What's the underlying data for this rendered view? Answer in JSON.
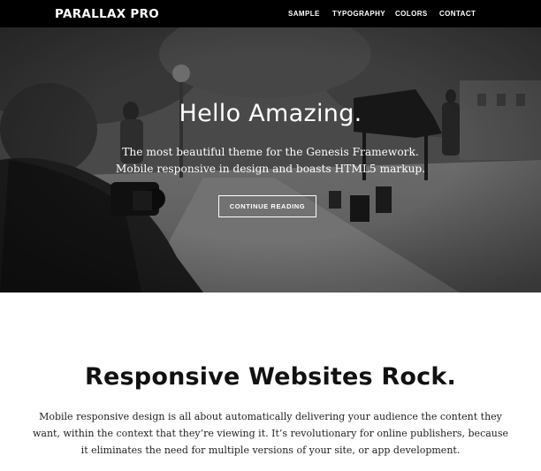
{
  "header": {
    "site_title": "PARALLAX PRO",
    "nav": [
      "SAMPLE",
      "TYPOGRAPHY",
      "COLORS",
      "CONTACT"
    ]
  },
  "hero": {
    "title": "Hello Amazing.",
    "lines": [
      "The most beautiful theme for the Genesis Framework.",
      "Mobile responsive in design and boasts HTML5 markup."
    ],
    "button_label": "CONTINUE READING"
  },
  "section": {
    "title": "Responsive Websites Rock.",
    "lines": [
      "Mobile responsive design is all about automatically delivering your audience the content they",
      "want, within the context that they’re viewing it. It’s revolutionary for online publishers, because",
      "it eliminates the need for multiple versions of your site, or app development."
    ]
  },
  "colors": {
    "header_bg": "#000000",
    "page_bg": "#ffffff",
    "hero_text": "#ffffff"
  }
}
